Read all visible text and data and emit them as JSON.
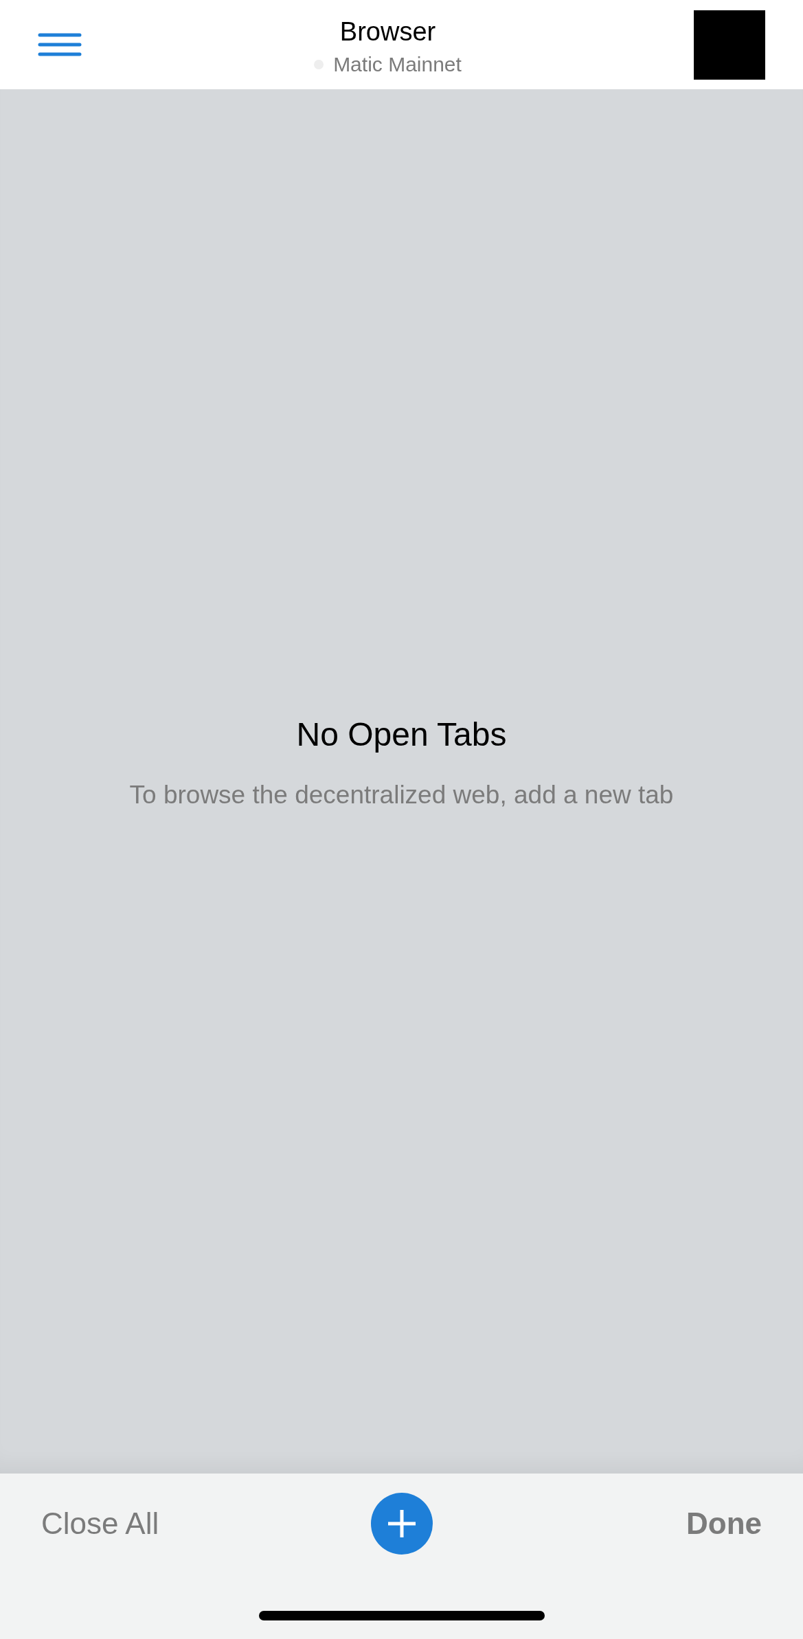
{
  "header": {
    "title": "Browser",
    "network": "Matic Mainnet"
  },
  "empty_state": {
    "title": "No Open Tabs",
    "message": "To browse the decentralized web, add a new tab"
  },
  "footer": {
    "close_all": "Close All",
    "done": "Done"
  }
}
